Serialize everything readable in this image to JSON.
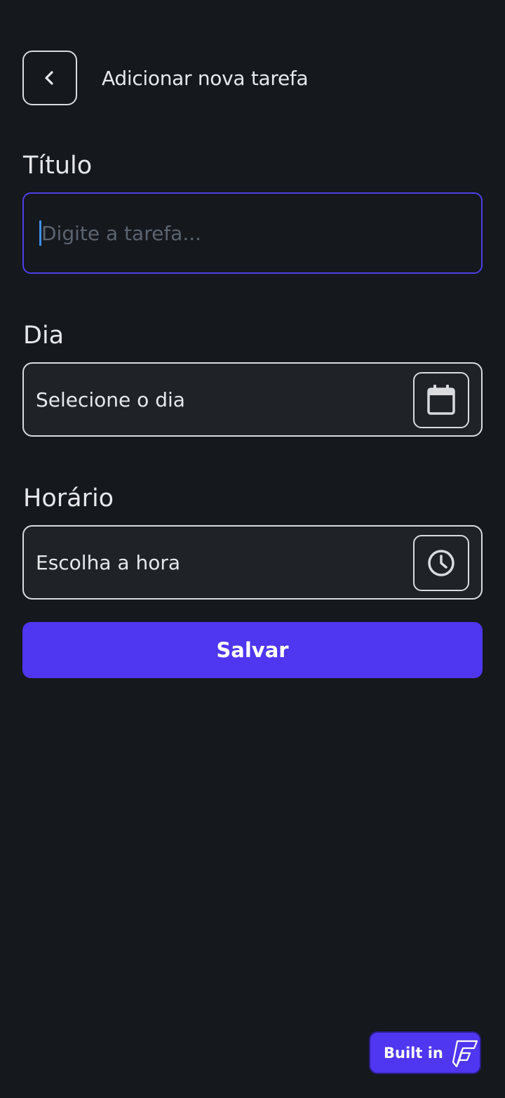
{
  "header": {
    "title": "Adicionar nova tarefa",
    "back_icon": "chevron-left-icon"
  },
  "title_field": {
    "label": "Título",
    "value": "",
    "placeholder": "Digite a  tarefa..."
  },
  "day_field": {
    "label": "Dia",
    "value": "Selecione o dia",
    "icon": "calendar-icon"
  },
  "time_field": {
    "label": "Horário",
    "value": "Escolha a hora",
    "icon": "clock-icon"
  },
  "save_button": {
    "label": "Salvar"
  },
  "badge": {
    "label": "Built in",
    "icon": "flutterflow-logo-icon"
  },
  "colors": {
    "background": "#15181c",
    "accent": "#4f36f0",
    "input_focus_border": "#4f3ee6",
    "field_background": "#1f2328",
    "border": "#d9dbde",
    "placeholder": "#5b646f"
  }
}
